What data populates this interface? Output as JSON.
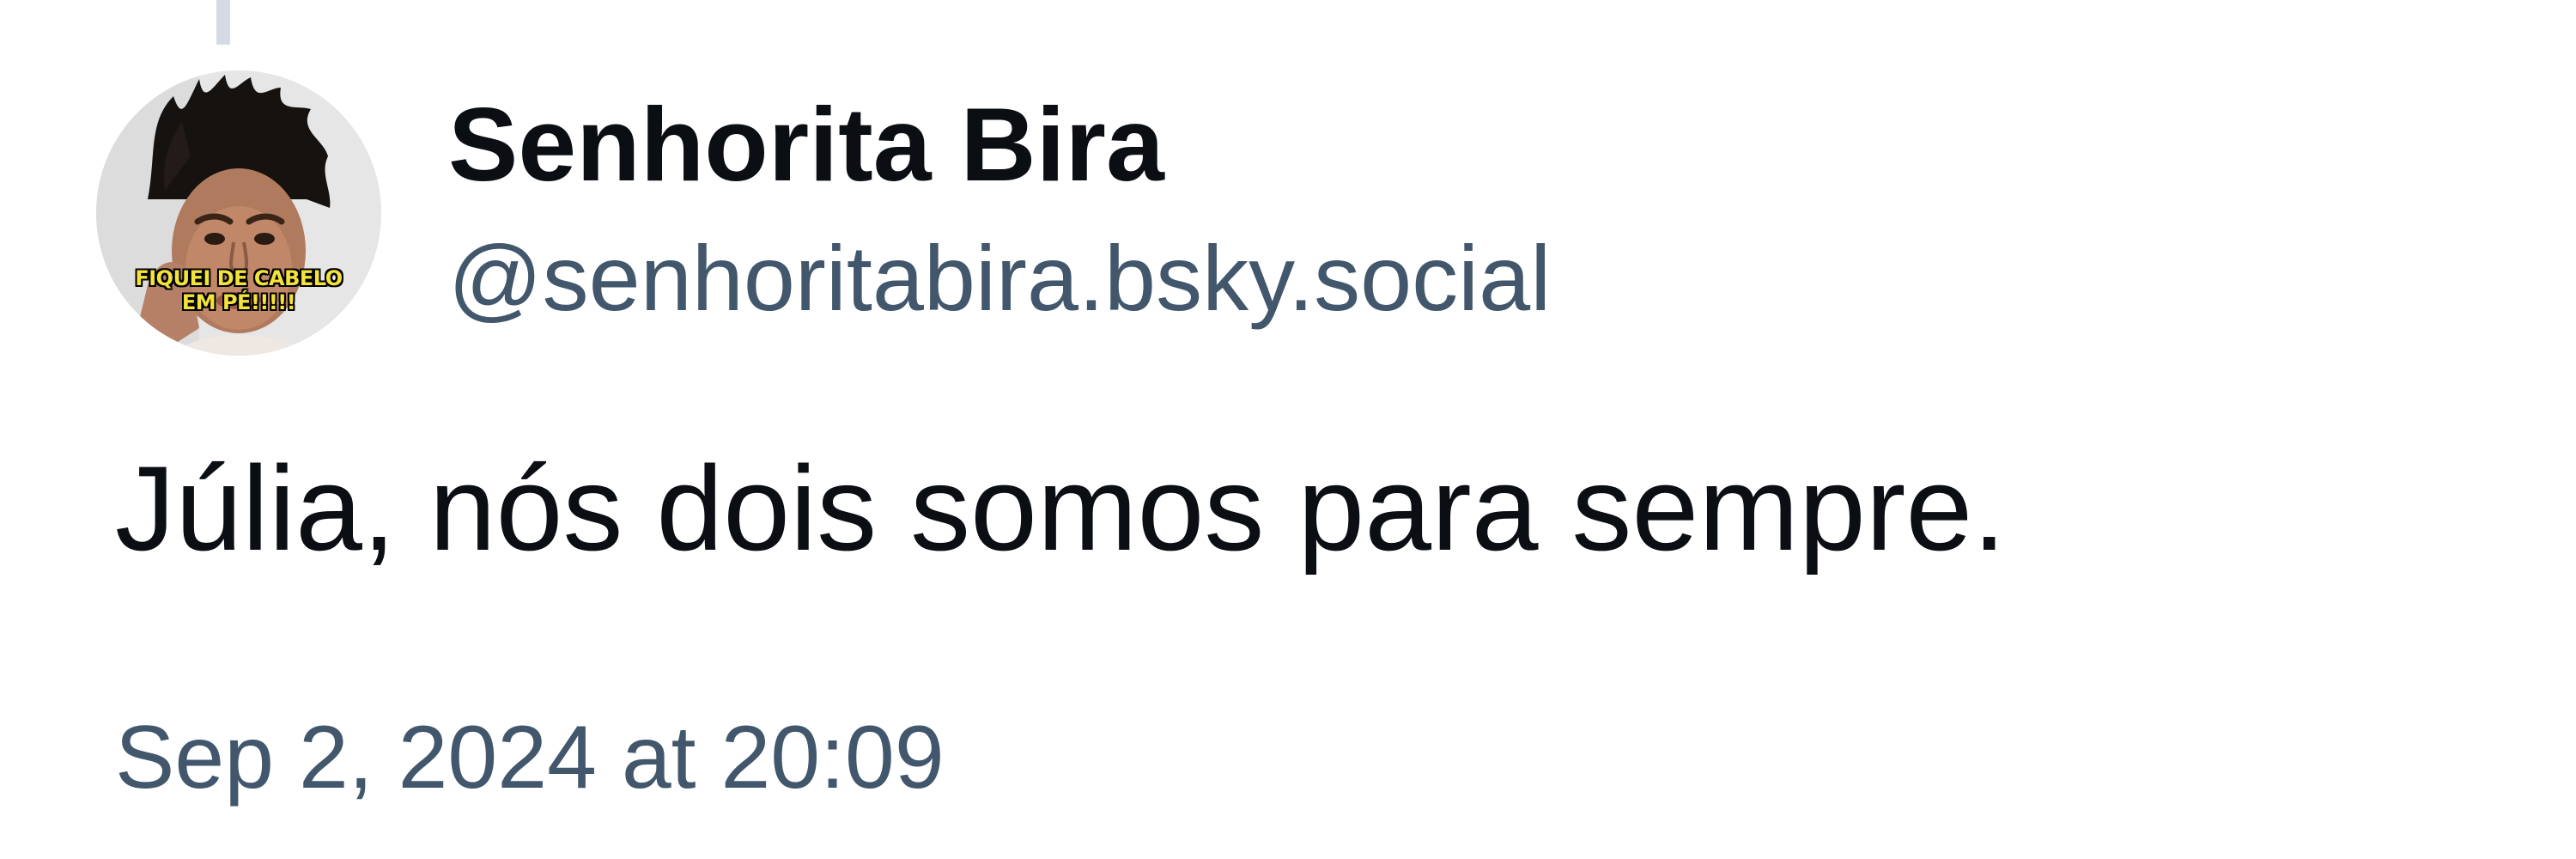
{
  "post": {
    "author": {
      "display_name": "Senhorita Bira",
      "handle": "@senhoritabira.bsky.social",
      "avatar": {
        "caption_line1": "FIQUEI DE CABELO",
        "caption_line2": "EM PÉ!!!!!"
      }
    },
    "text": "Júlia, nós dois somos para sempre.",
    "timestamp": "Sep 2, 2024 at 20:09"
  },
  "colors": {
    "background": "#ffffff",
    "primary_text": "#0b0f14",
    "secondary_text": "#42576c",
    "thread_line": "#d4dbe2",
    "avatar_caption": "#f3e33a"
  }
}
